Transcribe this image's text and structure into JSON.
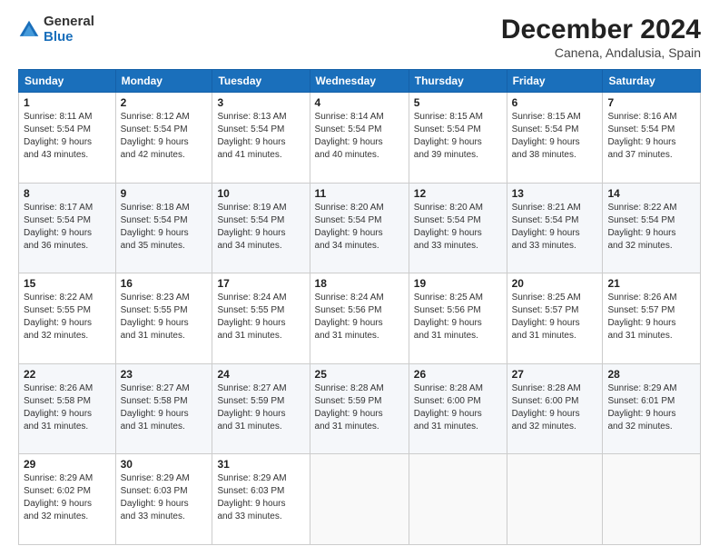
{
  "logo": {
    "general": "General",
    "blue": "Blue"
  },
  "title": "December 2024",
  "subtitle": "Canena, Andalusia, Spain",
  "days_of_week": [
    "Sunday",
    "Monday",
    "Tuesday",
    "Wednesday",
    "Thursday",
    "Friday",
    "Saturday"
  ],
  "weeks": [
    [
      {
        "day": "1",
        "info": "Sunrise: 8:11 AM\nSunset: 5:54 PM\nDaylight: 9 hours\nand 43 minutes."
      },
      {
        "day": "2",
        "info": "Sunrise: 8:12 AM\nSunset: 5:54 PM\nDaylight: 9 hours\nand 42 minutes."
      },
      {
        "day": "3",
        "info": "Sunrise: 8:13 AM\nSunset: 5:54 PM\nDaylight: 9 hours\nand 41 minutes."
      },
      {
        "day": "4",
        "info": "Sunrise: 8:14 AM\nSunset: 5:54 PM\nDaylight: 9 hours\nand 40 minutes."
      },
      {
        "day": "5",
        "info": "Sunrise: 8:15 AM\nSunset: 5:54 PM\nDaylight: 9 hours\nand 39 minutes."
      },
      {
        "day": "6",
        "info": "Sunrise: 8:15 AM\nSunset: 5:54 PM\nDaylight: 9 hours\nand 38 minutes."
      },
      {
        "day": "7",
        "info": "Sunrise: 8:16 AM\nSunset: 5:54 PM\nDaylight: 9 hours\nand 37 minutes."
      }
    ],
    [
      {
        "day": "8",
        "info": "Sunrise: 8:17 AM\nSunset: 5:54 PM\nDaylight: 9 hours\nand 36 minutes."
      },
      {
        "day": "9",
        "info": "Sunrise: 8:18 AM\nSunset: 5:54 PM\nDaylight: 9 hours\nand 35 minutes."
      },
      {
        "day": "10",
        "info": "Sunrise: 8:19 AM\nSunset: 5:54 PM\nDaylight: 9 hours\nand 34 minutes."
      },
      {
        "day": "11",
        "info": "Sunrise: 8:20 AM\nSunset: 5:54 PM\nDaylight: 9 hours\nand 34 minutes."
      },
      {
        "day": "12",
        "info": "Sunrise: 8:20 AM\nSunset: 5:54 PM\nDaylight: 9 hours\nand 33 minutes."
      },
      {
        "day": "13",
        "info": "Sunrise: 8:21 AM\nSunset: 5:54 PM\nDaylight: 9 hours\nand 33 minutes."
      },
      {
        "day": "14",
        "info": "Sunrise: 8:22 AM\nSunset: 5:54 PM\nDaylight: 9 hours\nand 32 minutes."
      }
    ],
    [
      {
        "day": "15",
        "info": "Sunrise: 8:22 AM\nSunset: 5:55 PM\nDaylight: 9 hours\nand 32 minutes."
      },
      {
        "day": "16",
        "info": "Sunrise: 8:23 AM\nSunset: 5:55 PM\nDaylight: 9 hours\nand 31 minutes."
      },
      {
        "day": "17",
        "info": "Sunrise: 8:24 AM\nSunset: 5:55 PM\nDaylight: 9 hours\nand 31 minutes."
      },
      {
        "day": "18",
        "info": "Sunrise: 8:24 AM\nSunset: 5:56 PM\nDaylight: 9 hours\nand 31 minutes."
      },
      {
        "day": "19",
        "info": "Sunrise: 8:25 AM\nSunset: 5:56 PM\nDaylight: 9 hours\nand 31 minutes."
      },
      {
        "day": "20",
        "info": "Sunrise: 8:25 AM\nSunset: 5:57 PM\nDaylight: 9 hours\nand 31 minutes."
      },
      {
        "day": "21",
        "info": "Sunrise: 8:26 AM\nSunset: 5:57 PM\nDaylight: 9 hours\nand 31 minutes."
      }
    ],
    [
      {
        "day": "22",
        "info": "Sunrise: 8:26 AM\nSunset: 5:58 PM\nDaylight: 9 hours\nand 31 minutes."
      },
      {
        "day": "23",
        "info": "Sunrise: 8:27 AM\nSunset: 5:58 PM\nDaylight: 9 hours\nand 31 minutes."
      },
      {
        "day": "24",
        "info": "Sunrise: 8:27 AM\nSunset: 5:59 PM\nDaylight: 9 hours\nand 31 minutes."
      },
      {
        "day": "25",
        "info": "Sunrise: 8:28 AM\nSunset: 5:59 PM\nDaylight: 9 hours\nand 31 minutes."
      },
      {
        "day": "26",
        "info": "Sunrise: 8:28 AM\nSunset: 6:00 PM\nDaylight: 9 hours\nand 31 minutes."
      },
      {
        "day": "27",
        "info": "Sunrise: 8:28 AM\nSunset: 6:00 PM\nDaylight: 9 hours\nand 32 minutes."
      },
      {
        "day": "28",
        "info": "Sunrise: 8:29 AM\nSunset: 6:01 PM\nDaylight: 9 hours\nand 32 minutes."
      }
    ],
    [
      {
        "day": "29",
        "info": "Sunrise: 8:29 AM\nSunset: 6:02 PM\nDaylight: 9 hours\nand 32 minutes."
      },
      {
        "day": "30",
        "info": "Sunrise: 8:29 AM\nSunset: 6:03 PM\nDaylight: 9 hours\nand 33 minutes."
      },
      {
        "day": "31",
        "info": "Sunrise: 8:29 AM\nSunset: 6:03 PM\nDaylight: 9 hours\nand 33 minutes."
      },
      {
        "day": "",
        "info": ""
      },
      {
        "day": "",
        "info": ""
      },
      {
        "day": "",
        "info": ""
      },
      {
        "day": "",
        "info": ""
      }
    ]
  ]
}
